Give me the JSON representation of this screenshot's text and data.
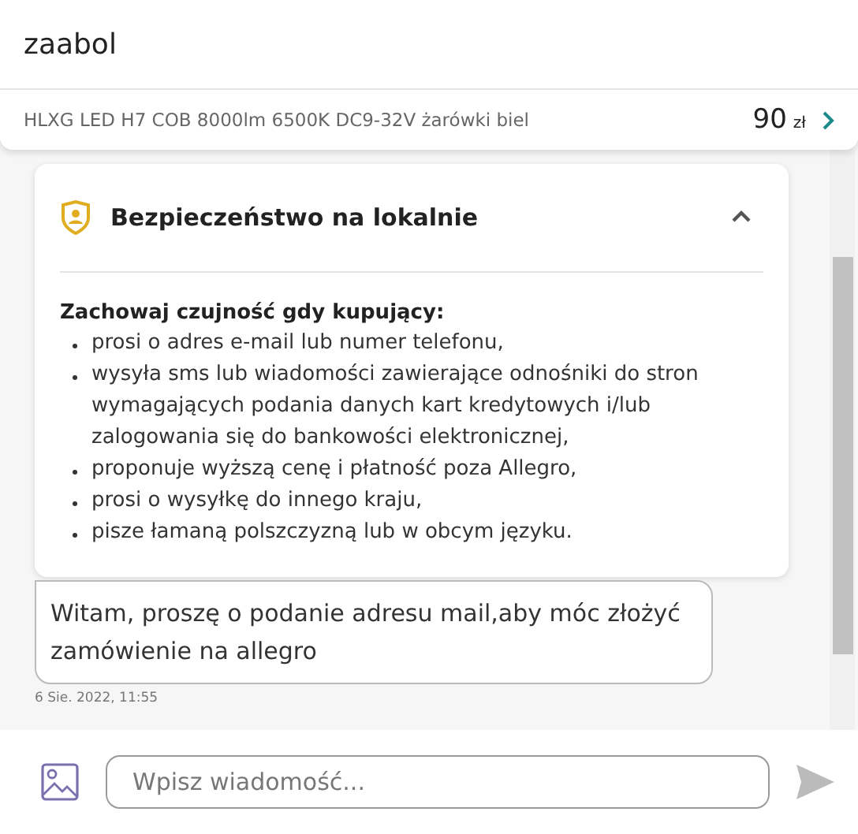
{
  "header": {
    "title": "zaabol"
  },
  "product": {
    "name": "HLXG LED H7 COB 8000lm 6500K DC9-32V żarówki biel",
    "price": "90",
    "currency": "zł"
  },
  "safety_card": {
    "title": "Bezpieczeństwo na lokalnie",
    "expanded": true,
    "intro": "Zachowaj czujność gdy kupujący:",
    "items": [
      "prosi o adres e-mail lub numer telefonu,",
      "wysyła sms lub wiadomości zawierające odnośniki do stron wymagających podania danych kart kredytowych i/lub zalogowania się do bankowości elektronicznej,",
      "proponuje wyższą cenę i płatność poza Allegro,",
      "prosi o wysyłkę do innego kraju,",
      "pisze łamaną polszczyzną lub w obcym języku."
    ]
  },
  "messages": [
    {
      "text": "Witam, proszę o podanie adresu mail,aby móc złożyć zamówienie na allegro",
      "time": "6 Sie. 2022, 11:55"
    }
  ],
  "composer": {
    "placeholder": "Wpisz wiadomość..."
  }
}
